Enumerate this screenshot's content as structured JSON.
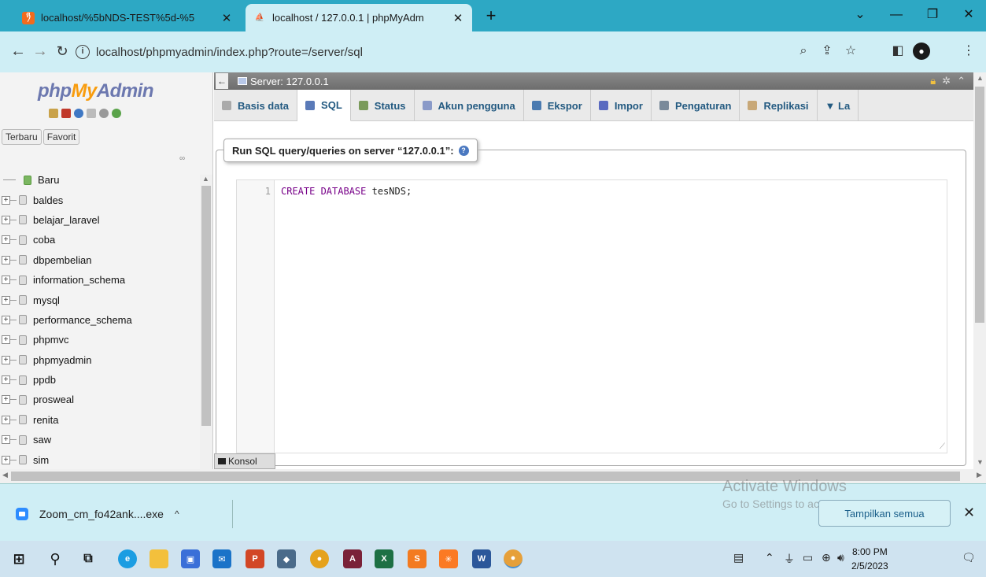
{
  "browser": {
    "tabs": [
      {
        "title": "localhost/%5bNDS-TEST%5d-%5",
        "active": false,
        "close": "✕"
      },
      {
        "title": "localhost / 127.0.0.1 | phpMyAdm",
        "active": true,
        "close": "✕"
      }
    ],
    "new_tab": "+",
    "window_controls": {
      "dropdown": "⌄",
      "minimize": "—",
      "maximize": "❐",
      "close": "✕"
    },
    "url": "localhost/phpmyadmin/index.php?route=/server/sql",
    "info_icon": "i"
  },
  "pma": {
    "logo": {
      "php": "php",
      "my": "My",
      "admin": "Admin"
    },
    "recent_label": "Terbaru",
    "favorites_label": "Favorit",
    "new_label": "Baru",
    "databases": [
      "baldes",
      "belajar_laravel",
      "coba",
      "dbpembelian",
      "information_schema",
      "mysql",
      "performance_schema",
      "phpmvc",
      "phpmyadmin",
      "ppdb",
      "prosweal",
      "renita",
      "saw",
      "sim"
    ],
    "server_label": "Server: 127.0.0.1",
    "menu": [
      {
        "label": "Basis data",
        "active": false
      },
      {
        "label": "SQL",
        "active": true
      },
      {
        "label": "Status",
        "active": false
      },
      {
        "label": "Akun pengguna",
        "active": false
      },
      {
        "label": "Ekspor",
        "active": false
      },
      {
        "label": "Impor",
        "active": false
      },
      {
        "label": "Pengaturan",
        "active": false
      },
      {
        "label": "Replikasi",
        "active": false
      },
      {
        "label": "▼ La",
        "active": false
      }
    ],
    "query_legend": "Run SQL query/queries on server “127.0.0.1”:",
    "editor": {
      "line_number": "1",
      "code_keyword": "CREATE DATABASE",
      "code_rest": " tesNDS;"
    },
    "console_label": "Konsol"
  },
  "downloads": {
    "filename": "Zoom_cm_fo42ank....exe",
    "caret": "^",
    "show_all": "Tampilkan semua",
    "close": "✕"
  },
  "watermark": {
    "line1": "Activate Windows",
    "line2": "Go to Settings to activate Windows."
  },
  "taskbar": {
    "time": "8:00 PM",
    "date": "2/5/2023"
  },
  "colors": {
    "tabbar": "#2da8c4",
    "toolbar": "#cfeef5",
    "pma_link": "#235a81",
    "logo_blue": "#6c78af",
    "logo_orange": "#f89c0e"
  }
}
